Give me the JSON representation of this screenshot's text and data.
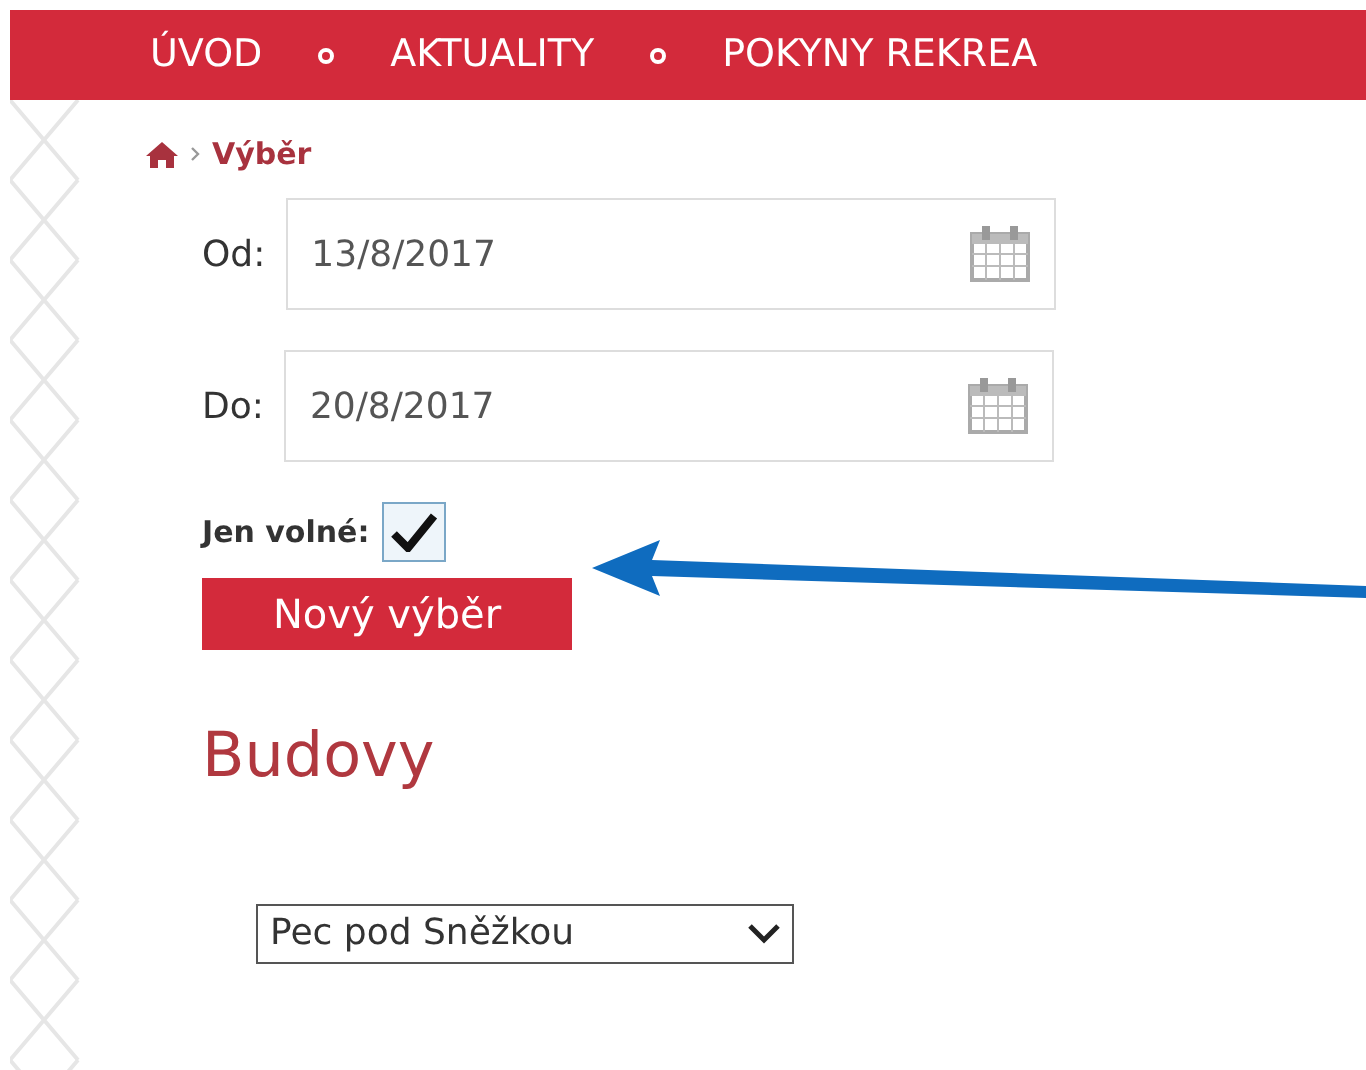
{
  "nav": {
    "items": [
      "ÚVOD",
      "AKTUALITY",
      "POKYNY REKREA"
    ]
  },
  "breadcrumb": {
    "current": "Výběr"
  },
  "date_fields": [
    {
      "label": "Od:",
      "value": "13/8/2017"
    },
    {
      "label": "Do:",
      "value": "20/8/2017"
    }
  ],
  "filter": {
    "label": "Jen volné:",
    "checked": true
  },
  "button": "Nový výběr",
  "section_title": "Budovy",
  "building_select": {
    "value": "Pec pod Sněžkou"
  }
}
